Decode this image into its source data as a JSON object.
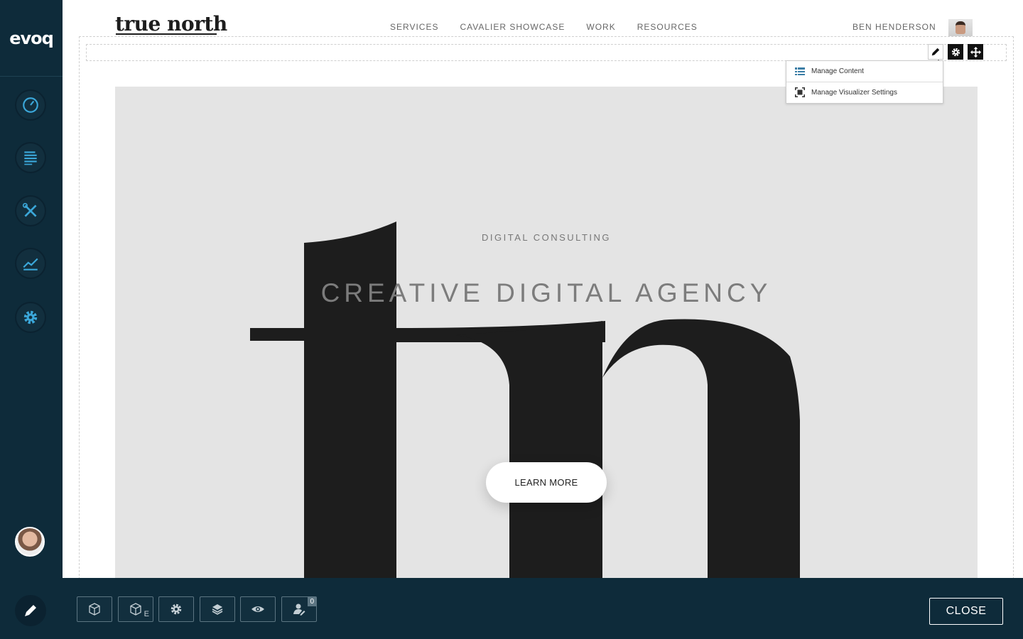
{
  "persona_bar": {
    "logo": "evoq",
    "items": [
      {
        "name": "dashboard",
        "icon": "speedometer-icon"
      },
      {
        "name": "content",
        "icon": "content-list-icon"
      },
      {
        "name": "manage",
        "icon": "tools-icon"
      },
      {
        "name": "analytics",
        "icon": "line-chart-icon"
      },
      {
        "name": "settings",
        "icon": "gear-icon"
      }
    ],
    "accent_color": "#3ba7d9",
    "background_color": "#0e2b3a"
  },
  "site": {
    "logo": "true north",
    "nav": [
      "SERVICES",
      "CAVALIER SHOWCASE",
      "WORK",
      "RESOURCES"
    ],
    "user_name": "BEN HENDERSON"
  },
  "module_menu": {
    "items": [
      {
        "label": "Manage Content",
        "icon": "manage-content-icon"
      },
      {
        "label": "Manage Visualizer Settings",
        "icon": "visualizer-settings-icon"
      }
    ]
  },
  "hero": {
    "eyebrow": "DIGITAL CONSULTING",
    "title": "CREATIVE DIGITAL AGENCY",
    "cta": "LEARN MORE",
    "background_color": "#e4e4e4"
  },
  "edit_bar": {
    "buttons": [
      {
        "name": "add-module",
        "icon": "cube-icon"
      },
      {
        "name": "add-existing-module",
        "icon": "cube-icon",
        "suffix": "E"
      },
      {
        "name": "page-settings",
        "icon": "gear-icon"
      },
      {
        "name": "page-layers",
        "icon": "layers-icon"
      },
      {
        "name": "preview",
        "icon": "eye-icon"
      },
      {
        "name": "users",
        "icon": "user-edit-icon",
        "badge": "0"
      }
    ],
    "close_label": "CLOSE"
  }
}
